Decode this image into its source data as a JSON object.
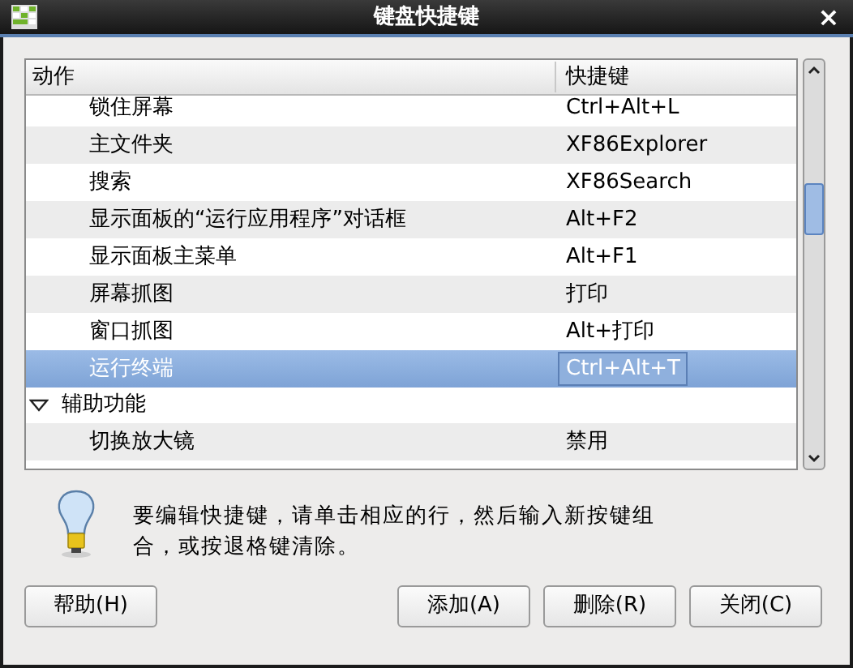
{
  "window": {
    "title": "键盘快捷键",
    "close": "×"
  },
  "table": {
    "columns": [
      "动作",
      "快捷键"
    ],
    "rows": [
      {
        "kind": "item",
        "action": "锁住屏幕",
        "shortcut": "Ctrl+Alt+L",
        "selected": false
      },
      {
        "kind": "item",
        "action": "主文件夹",
        "shortcut": "XF86Explorer",
        "selected": false
      },
      {
        "kind": "item",
        "action": "搜索",
        "shortcut": "XF86Search",
        "selected": false
      },
      {
        "kind": "item",
        "action": "显示面板的“运行应用程序”对话框",
        "shortcut": "Alt+F2",
        "selected": false
      },
      {
        "kind": "item",
        "action": "显示面板主菜单",
        "shortcut": "Alt+F1",
        "selected": false
      },
      {
        "kind": "item",
        "action": "屏幕抓图",
        "shortcut": "打印",
        "selected": false
      },
      {
        "kind": "item",
        "action": "窗口抓图",
        "shortcut": "Alt+打印",
        "selected": false
      },
      {
        "kind": "item",
        "action": "运行终端",
        "shortcut": "Ctrl+Alt+T",
        "selected": true
      },
      {
        "kind": "group",
        "label": "辅助功能",
        "expanded": true,
        "children": [
          {
            "kind": "item",
            "action": "切换放大镜",
            "shortcut": "禁用",
            "selected": false
          }
        ]
      }
    ]
  },
  "hint": "要编辑快捷键，请单击相应的行，然后输入新按键组合，或按退格键清除。",
  "buttons": [
    "帮助(H)",
    "添加(A)",
    "删除(R)",
    "关闭(C)"
  ]
}
